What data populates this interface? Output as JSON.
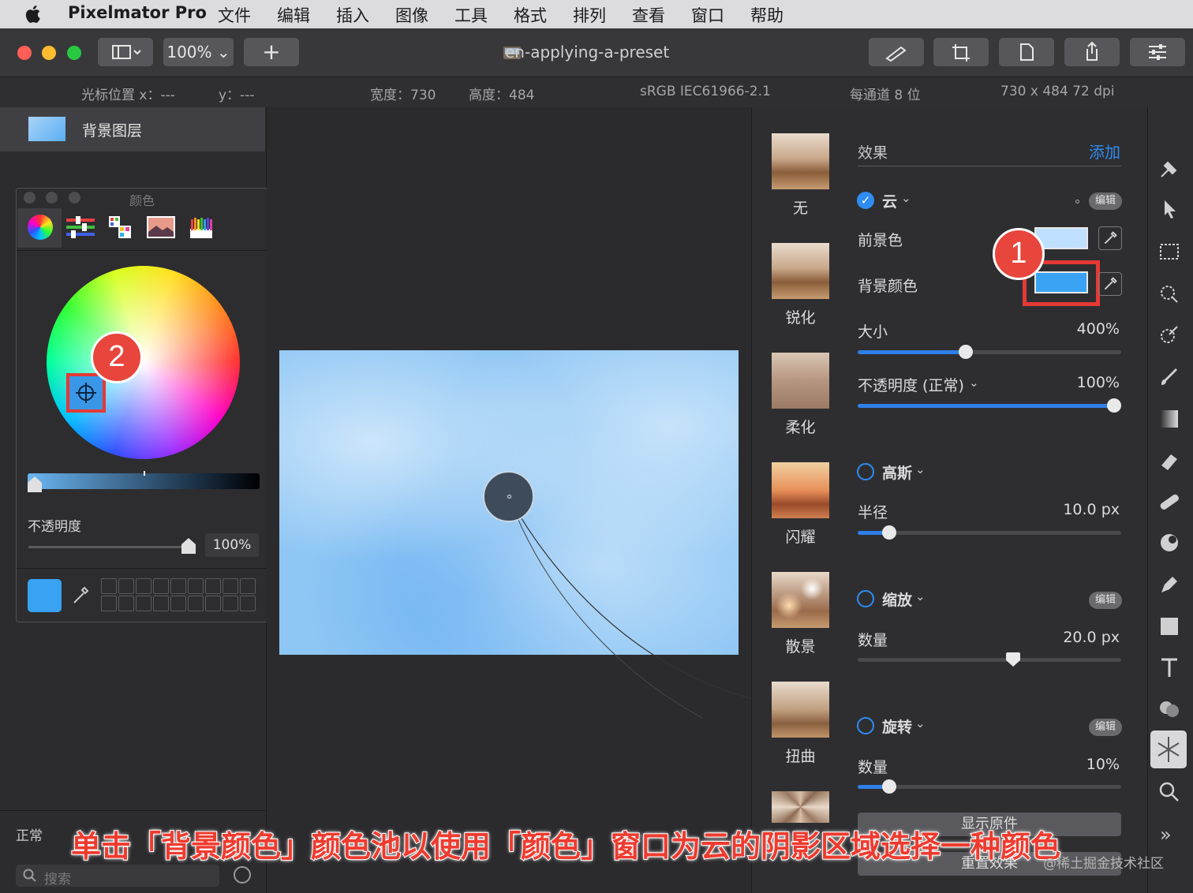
{
  "menubar": {
    "app_name": "Pixelmator Pro",
    "items": [
      "文件",
      "编辑",
      "插入",
      "图像",
      "工具",
      "格式",
      "排列",
      "查看",
      "窗口",
      "帮助"
    ]
  },
  "toolbar": {
    "zoom": "100%",
    "add": "+",
    "title": "en-applying-a-preset"
  },
  "infobar": {
    "cursor_x": "光标位置 x：---",
    "cursor_y": "y：---",
    "width": "宽度：730",
    "height": "高度：484",
    "profile": "sRGB IEC61966-2.1",
    "depth": "每通道 8 位",
    "size": "730 x 484 72 dpi"
  },
  "layers": {
    "name": "背景图层",
    "blend": "正常",
    "search_placeholder": "搜索"
  },
  "color_panel": {
    "title": "颜色",
    "opacity_label": "不透明度",
    "opacity_value": "100%",
    "current_color": "#3aa2f2"
  },
  "presets": [
    "无",
    "锐化",
    "柔化",
    "闪耀",
    "散景",
    "扭曲"
  ],
  "effects": {
    "header": "效果",
    "add": "添加",
    "edit": "编辑",
    "cloud": {
      "name": "云",
      "foreground_label": "前景色",
      "foreground_color": "#bfe0ff",
      "background_label": "背景颜色",
      "background_color": "#3aa2f2",
      "size_label": "大小",
      "size_value": "400%",
      "size_fraction": 0.41,
      "opacity_label": "不透明度 (正常)",
      "opacity_value": "100%",
      "opacity_fraction": 1.0
    },
    "gaussian": {
      "name": "高斯",
      "radius_label": "半径",
      "radius_value": "10.0 px",
      "radius_fraction": 0.12
    },
    "zoom": {
      "name": "缩放",
      "amount_label": "数量",
      "amount_value": "20.0 px",
      "amount_fraction": 0.59
    },
    "spin": {
      "name": "旋转",
      "amount_label": "数量",
      "amount_value": "10%",
      "amount_fraction": 0.12
    },
    "show_original": "显示原件",
    "reset": "重置效果"
  },
  "annotations": {
    "badge1": "1",
    "badge2": "2"
  },
  "caption": "单击「背景颜色」颜色池以使用「颜色」窗口为云的阴影区域选择一种颜色",
  "watermark": "@稀土掘金技术社区",
  "colors": {
    "accent": "#2f8cf0",
    "highlight": "#e53935"
  }
}
